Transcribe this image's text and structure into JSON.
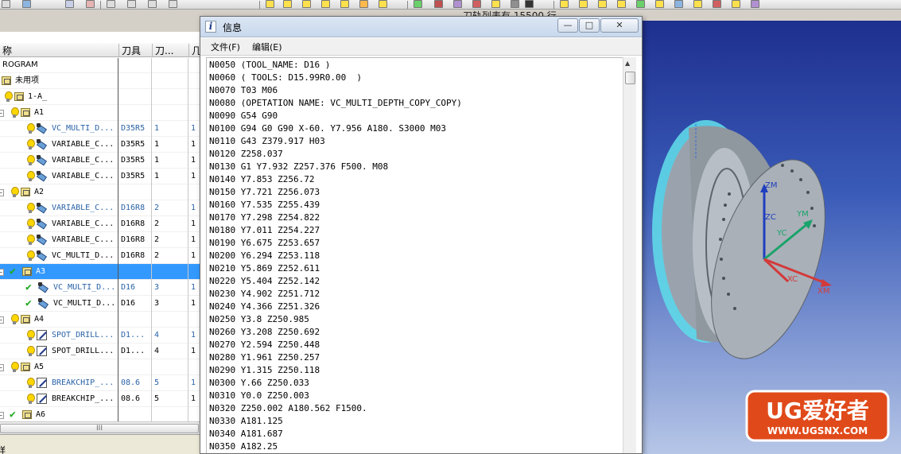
{
  "toolbar": {
    "background_title": "刀轨列表有 15500 行"
  },
  "navigator": {
    "columns": [
      "称",
      "刀具",
      "刀...",
      "几"
    ],
    "rows": [
      {
        "name": "ROGRAM",
        "tool": "",
        "num": "",
        "last": "",
        "icon": "none",
        "indent": 0
      },
      {
        "name": "未用项",
        "tool": "",
        "num": "",
        "last": "",
        "icon": "folder",
        "indent": 0
      },
      {
        "name": "1-A_",
        "tool": "",
        "num": "",
        "last": "",
        "icon": "bulb-folder",
        "indent": 0
      },
      {
        "name": "A1",
        "tool": "",
        "num": "",
        "last": "",
        "icon": "bulb-folder",
        "indent": 1
      },
      {
        "name": "VC_MULTI_D...",
        "tool": "D35R5",
        "num": "1",
        "last": "1",
        "icon": "bulb-op",
        "indent": 2,
        "blue": true
      },
      {
        "name": "VARIABLE_C...",
        "tool": "D35R5",
        "num": "1",
        "last": "1",
        "icon": "bulb-op",
        "indent": 2
      },
      {
        "name": "VARIABLE_C...",
        "tool": "D35R5",
        "num": "1",
        "last": "1",
        "icon": "bulb-op",
        "indent": 2
      },
      {
        "name": "VARIABLE_C...",
        "tool": "D35R5",
        "num": "1",
        "last": "1",
        "icon": "bulb-op",
        "indent": 2
      },
      {
        "name": "A2",
        "tool": "",
        "num": "",
        "last": "",
        "icon": "bulb-folder",
        "indent": 1
      },
      {
        "name": "VARIABLE_C...",
        "tool": "D16R8",
        "num": "2",
        "last": "1",
        "icon": "bulb-op",
        "indent": 2,
        "blue": true
      },
      {
        "name": "VARIABLE_C...",
        "tool": "D16R8",
        "num": "2",
        "last": "1",
        "icon": "bulb-op",
        "indent": 2
      },
      {
        "name": "VARIABLE_C...",
        "tool": "D16R8",
        "num": "2",
        "last": "1",
        "icon": "bulb-op",
        "indent": 2
      },
      {
        "name": "VC_MULTI_D...",
        "tool": "D16R8",
        "num": "2",
        "last": "1",
        "icon": "bulb-op",
        "indent": 2
      },
      {
        "name": "A3",
        "tool": "",
        "num": "",
        "last": "",
        "icon": "check-folder",
        "indent": 1,
        "selected": true
      },
      {
        "name": "VC_MULTI_D...",
        "tool": "D16",
        "num": "3",
        "last": "1",
        "icon": "check-op",
        "indent": 2,
        "blue": true
      },
      {
        "name": "VC_MULTI_D...",
        "tool": "D16",
        "num": "3",
        "last": "1",
        "icon": "check-op",
        "indent": 2
      },
      {
        "name": "A4",
        "tool": "",
        "num": "",
        "last": "",
        "icon": "bulb-folder",
        "indent": 1
      },
      {
        "name": "SPOT_DRILL...",
        "tool": "D1...",
        "num": "4",
        "last": "1",
        "icon": "bulb-drill",
        "indent": 2,
        "blue": true
      },
      {
        "name": "SPOT_DRILL...",
        "tool": "D1...",
        "num": "4",
        "last": "1",
        "icon": "bulb-drill",
        "indent": 2
      },
      {
        "name": "A5",
        "tool": "",
        "num": "",
        "last": "",
        "icon": "bulb-folder",
        "indent": 1
      },
      {
        "name": "BREAKCHIP_...",
        "tool": "08.6",
        "num": "5",
        "last": "1",
        "icon": "bulb-drill",
        "indent": 2,
        "blue": true
      },
      {
        "name": "BREAKCHIP_...",
        "tool": "08.6",
        "num": "5",
        "last": "1",
        "icon": "bulb-drill",
        "indent": 2
      },
      {
        "name": "A6",
        "tool": "",
        "num": "",
        "last": "",
        "icon": "check-folder",
        "indent": 1
      }
    ],
    "hscroll_grip": "III",
    "bottom_label": "详"
  },
  "info_window": {
    "title": "信息",
    "buttons": {
      "minimize": "—",
      "maximize": "□",
      "close": "✕"
    },
    "menu": {
      "file": "文件(F)",
      "edit": "编辑(E)"
    },
    "lines": [
      "N0050 (TOOL_NAME: D16 )",
      "N0060 ( TOOLS: D15.99R0.00  )",
      "N0070 T03 M06",
      "N0080 (OPETATION NAME: VC_MULTI_DEPTH_COPY_COPY)",
      "N0090 G54 G90",
      "N0100 G94 G0 G90 X-60. Y7.956 A180. S3000 M03",
      "N0110 G43 Z379.917 H03",
      "N0120 Z258.037",
      "N0130 G1 Y7.932 Z257.376 F500. M08",
      "N0140 Y7.853 Z256.72",
      "N0150 Y7.721 Z256.073",
      "N0160 Y7.535 Z255.439",
      "N0170 Y7.298 Z254.822",
      "N0180 Y7.011 Z254.227",
      "N0190 Y6.675 Z253.657",
      "N0200 Y6.294 Z253.118",
      "N0210 Y5.869 Z252.611",
      "N0220 Y5.404 Z252.142",
      "N0230 Y4.902 Z251.712",
      "N0240 Y4.366 Z251.326",
      "N0250 Y3.8 Z250.985",
      "N0260 Y3.208 Z250.692",
      "N0270 Y2.594 Z250.448",
      "N0280 Y1.961 Z250.257",
      "N0290 Y1.315 Z250.118",
      "N0300 Y.66 Z250.033",
      "N0310 Y0.0 Z250.003",
      "N0320 Z250.002 A180.562 F1500.",
      "N0330 A181.125",
      "N0340 A181.687",
      "N0350 A182.25"
    ]
  },
  "viewport": {
    "axes": {
      "zm": "ZM",
      "zc": "ZC",
      "ym": "YM",
      "yc": "YC",
      "xc": "XC",
      "xm": "XM"
    }
  },
  "logo": {
    "text": "UG爱好者",
    "url": "WWW.UGSNX.COM"
  }
}
